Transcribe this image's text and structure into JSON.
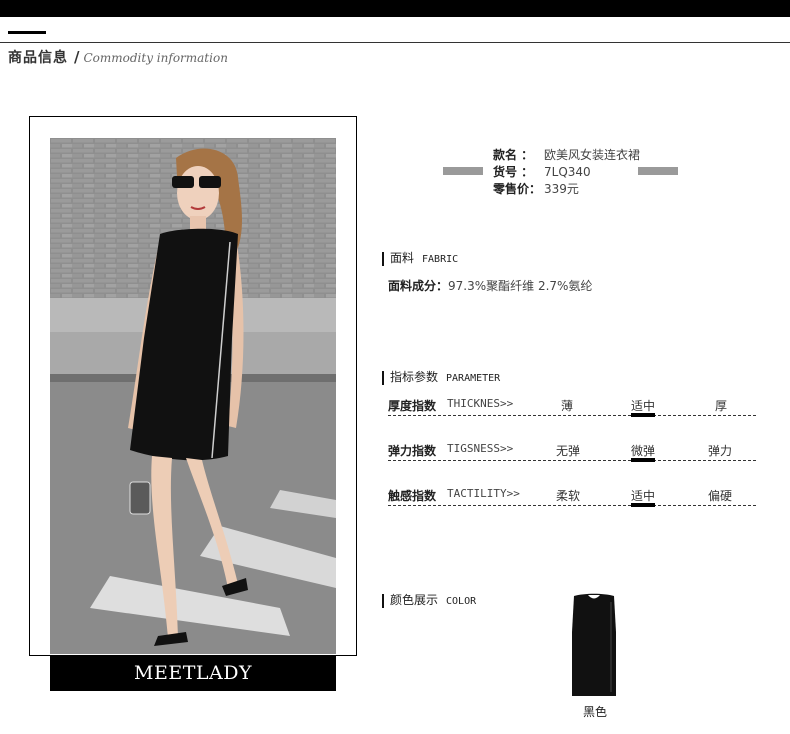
{
  "header": {
    "title_cn": "商品信息",
    "separator": "/",
    "title_en": "Commodity information"
  },
  "brand": "MEETLADY",
  "product": {
    "style_label": "款名 ：",
    "style_value": "欧美风女装连衣裙",
    "item_label": "货号 ：",
    "item_value": "7LQ340",
    "price_label": "零售价：",
    "price_value": "339元"
  },
  "fabric": {
    "section_cn": "面料",
    "section_en": "FABRIC",
    "label": "面料成分：",
    "value": "97.3%聚酯纤维 2.7%氨纶"
  },
  "parameter": {
    "section_cn": "指标参数",
    "section_en": "PARAMETER",
    "rows": [
      {
        "label": "厚度指数",
        "en": "THICKNES>>",
        "options": [
          "薄",
          "适中",
          "厚"
        ],
        "selected": 1
      },
      {
        "label": "弹力指数",
        "en": "TIGSNESS>>",
        "options": [
          "无弹",
          "微弹",
          "弹力"
        ],
        "selected": 1
      },
      {
        "label": "触感指数",
        "en": "TACTILITY>>",
        "options": [
          "柔软",
          "适中",
          "偏硬"
        ],
        "selected": 1
      }
    ]
  },
  "color": {
    "section_cn": "颜色展示",
    "section_en": "COLOR",
    "swatch_label": "黑色"
  },
  "colors": {
    "dress": "#111111",
    "divider_gray": "#9a9a9a"
  }
}
